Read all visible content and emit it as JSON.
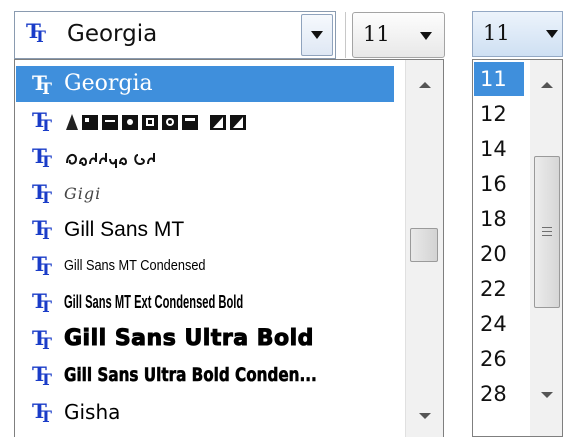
{
  "font_combo": {
    "value": "Georgia",
    "icon": "truetype-font-icon",
    "button_icon": "chevron-down-icon"
  },
  "size_combo": {
    "value": "11",
    "button_icon": "chevron-down-icon"
  },
  "font_list": {
    "items": [
      {
        "label": "Georgia",
        "selected": true
      },
      {
        "label": "Gigi",
        "selected": false
      },
      {
        "label": "Gill Sans MT",
        "selected": false
      },
      {
        "label": "Gill Sans MT Condensed",
        "selected": false
      },
      {
        "label": "Gill Sans MT Ext Condensed Bold",
        "selected": false
      },
      {
        "label": "Gill Sans Ultra Bold",
        "selected": false
      },
      {
        "label": "Gill Sans Ultra Bold Conden...",
        "selected": false
      },
      {
        "label": "Gisha",
        "selected": false
      }
    ],
    "symbol_rows": [
      "gigi-preview-symbols",
      "georgian-preview-glyphs"
    ]
  },
  "size_combo_open": {
    "value": "11"
  },
  "size_list": {
    "items": [
      "11",
      "12",
      "14",
      "16",
      "18",
      "20",
      "22",
      "24",
      "26",
      "28"
    ],
    "selected": "11"
  },
  "colors": {
    "selection": "#3f8fdc",
    "icon_blue": "#1a3cc8"
  }
}
